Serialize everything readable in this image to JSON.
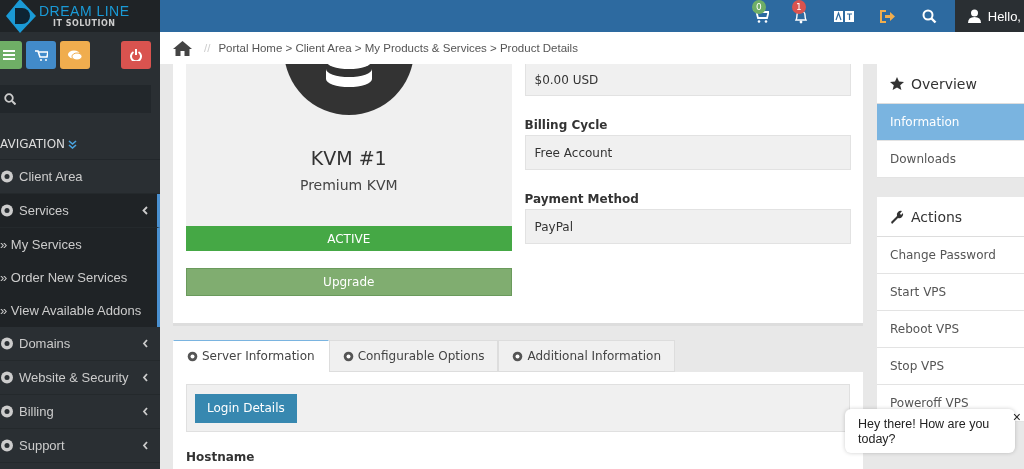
{
  "brand": {
    "name": "DREAM LINE",
    "tagline": "IT SOLUTION"
  },
  "top_bar": {
    "cart_count": "0",
    "notification_count": "1",
    "user": "Hello,"
  },
  "sidebar": {
    "heading": "AVIGATION",
    "items": [
      {
        "label": "Client Area"
      },
      {
        "label": "Services",
        "expanded": true,
        "children": [
          {
            "label": "» My Services"
          },
          {
            "label": "» Order New Services"
          },
          {
            "label": "» View Available Addons"
          }
        ]
      },
      {
        "label": "Domains",
        "expanded": false
      },
      {
        "label": "Website & Security",
        "expanded": false
      },
      {
        "label": "Billing",
        "expanded": false
      },
      {
        "label": "Support",
        "expanded": false
      }
    ]
  },
  "breadcrumb": {
    "separator": "//",
    "trail": "Portal Home > Client Area > My Products & Services > Product Details"
  },
  "product": {
    "name": "KVM #1",
    "group": "Premium KVM",
    "status": "ACTIVE",
    "active": true,
    "upgrade_button": "Upgrade"
  },
  "details": [
    {
      "value": "$0.00 USD"
    },
    {
      "label": "Billing Cycle",
      "value": "Free Account"
    },
    {
      "label": "Payment Method",
      "value": "PayPal"
    }
  ],
  "overview": {
    "title": "Overview",
    "items": [
      {
        "label": "Information",
        "selected": true
      },
      {
        "label": "Downloads",
        "selected": false
      }
    ]
  },
  "actions": {
    "title": "Actions",
    "items": [
      {
        "label": "Change Password"
      },
      {
        "label": "Start VPS"
      },
      {
        "label": "Reboot VPS"
      },
      {
        "label": "Stop VPS"
      },
      {
        "label": "Poweroff VPS"
      }
    ]
  },
  "tabs": [
    {
      "label": "Server Information",
      "selected": true
    },
    {
      "label": "Configurable Options",
      "selected": false
    },
    {
      "label": "Additional Information",
      "selected": false
    }
  ],
  "login_button": "Login Details",
  "hostname_label": "Hostname",
  "chat": {
    "message": "Hey there! How are you today?",
    "close": "×"
  }
}
